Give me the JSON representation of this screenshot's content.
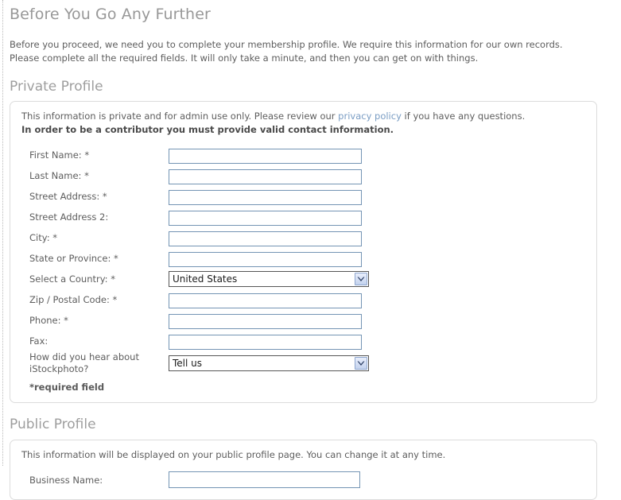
{
  "page": {
    "title": "Before You Go Any Further",
    "intro": "Before you proceed, we need you to complete your membership profile. We require this information for our own records. Please complete all the required fields. It will only take a minute, and then you can get on with things."
  },
  "private_section": {
    "heading": "Private Profile",
    "note_prefix": "This information is private and for admin use only. Please review our ",
    "note_link": "privacy policy",
    "note_suffix": " if you have any questions.",
    "note_bold": "In order to be a contributor you must provide valid contact information.",
    "required_note": "*required field",
    "fields": [
      {
        "label": "First Name: *",
        "type": "text",
        "value": "",
        "name": "first-name"
      },
      {
        "label": "Last Name: *",
        "type": "text",
        "value": "",
        "name": "last-name"
      },
      {
        "label": "Street Address: *",
        "type": "text",
        "value": "",
        "name": "street-address"
      },
      {
        "label": "Street Address 2:",
        "type": "text",
        "value": "",
        "name": "street-address-2"
      },
      {
        "label": "City: *",
        "type": "text",
        "value": "",
        "name": "city"
      },
      {
        "label": "State or Province: *",
        "type": "text",
        "value": "",
        "name": "state-or-province"
      },
      {
        "label": "Select a Country: *",
        "type": "select",
        "value": "United States",
        "name": "country"
      },
      {
        "label": "Zip / Postal Code: *",
        "type": "text",
        "value": "",
        "name": "zip-postal-code"
      },
      {
        "label": "Phone: *",
        "type": "text",
        "value": "",
        "name": "phone"
      },
      {
        "label": "Fax:",
        "type": "text",
        "value": "",
        "name": "fax"
      },
      {
        "label": "How did you hear about iStockphoto?",
        "type": "select",
        "value": "Tell us",
        "name": "referral-source"
      }
    ]
  },
  "public_section": {
    "heading": "Public Profile",
    "note": "This information will be displayed on your public profile page. You can change it at any time.",
    "fields": [
      {
        "label": "Business Name:",
        "type": "text",
        "value": "",
        "name": "business-name"
      }
    ]
  },
  "colors": {
    "heading_gray": "#9e9e9e",
    "body_text": "#5d5d5d",
    "link_blue": "#7a9dc4",
    "input_border": "#7494b4",
    "panel_border": "#dcdcdc",
    "select_button": "#c3d2ee"
  }
}
